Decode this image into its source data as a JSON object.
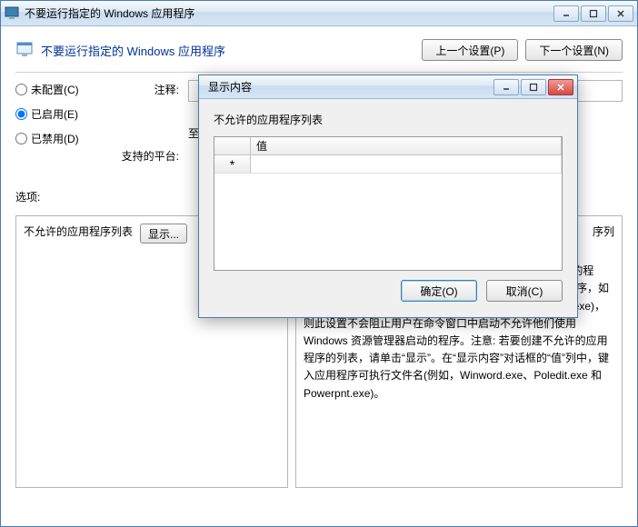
{
  "mainWindow": {
    "title": "不要运行指定的 Windows 应用程序",
    "headerTitle": "不要运行指定的 Windows 应用程序",
    "nav": {
      "prev": "上一个设置(P)",
      "next": "下一个设置(N)"
    },
    "radios": {
      "notConfigured": "未配置(C)",
      "enabled": "已启用(E)",
      "disabled": "已禁用(D)"
    },
    "labels": {
      "comment": "注释:",
      "supportedOn": "支持的平台:"
    },
    "inputs": {
      "commentValue": "",
      "supportedOnText": "至少"
    },
    "optionsLabel": "选项:",
    "leftPanel": {
      "listLabel": "不允许的应用程序列表",
      "showButton": "显示..."
    },
    "rightPanel": {
      "helpTextTop": "序列",
      "helpText": "此设置仅阻止用户运行由 Windows 资源管理器进程启动的程序。它不会阻止用户运行由系统进程或其他进程启动的程序，如任务管理器。另外，如果允许用户使用命令提示符(Cmd.exe)，则此设置不会阻止用户在命令窗口中启动不允许他们使用 Windows 资源管理器启动的程序。注意: 若要创建不允许的应用程序的列表，请单击“显示”。在“显示内容”对话框的“值”列中，键入应用程序可执行文件名(例如，Winword.exe、Poledit.exe 和 Powerpnt.exe)。"
    }
  },
  "dialog": {
    "title": "显示内容",
    "subtitle": "不允许的应用程序列表",
    "table": {
      "headerIndex": "",
      "headerValue": "值",
      "rowMarker": "*",
      "rowValue": ""
    },
    "buttons": {
      "ok": "确定(O)",
      "cancel": "取消(C)"
    }
  }
}
